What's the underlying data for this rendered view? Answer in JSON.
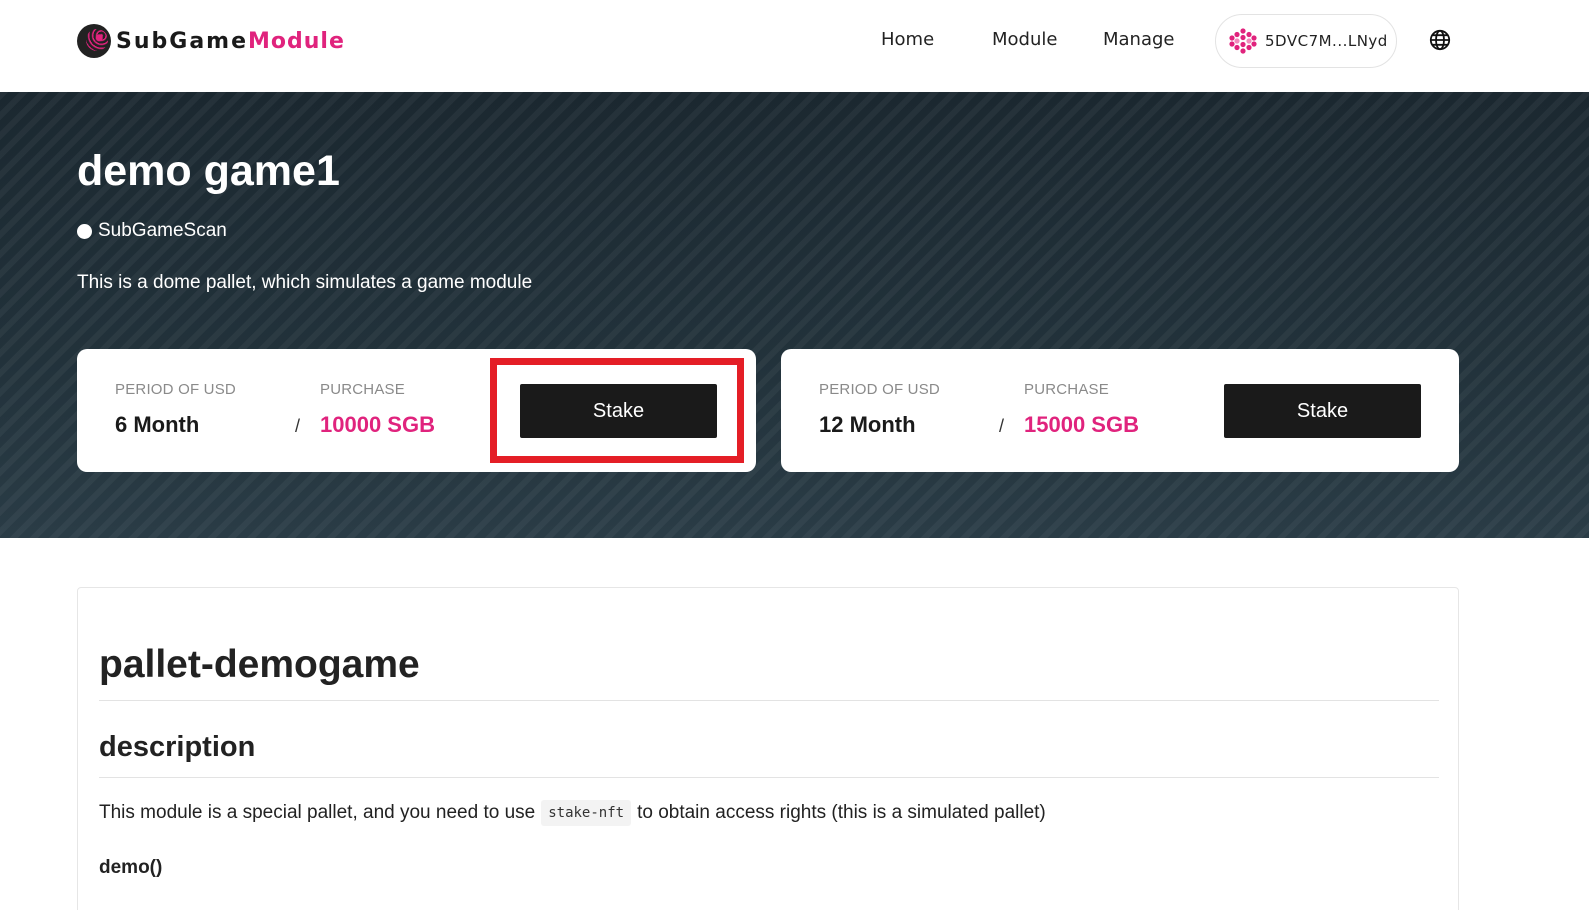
{
  "header": {
    "logo": {
      "part1": "SubGame",
      "part2": "Module"
    },
    "nav": {
      "home": "Home",
      "module": "Module",
      "manage": "Manage"
    },
    "wallet": {
      "address": "5DVC7M...LNyd",
      "icon": "wallet-identicon"
    },
    "language_icon": "globe-icon"
  },
  "hero": {
    "title": "demo game1",
    "link": "SubGameScan",
    "description": "This is a dome pallet, which simulates a game module",
    "plans": [
      {
        "period_label": "PERIOD OF USD",
        "period": "6 Month",
        "purchase_label": "PURCHASE",
        "purchase": "10000 SGB",
        "separator": "/",
        "button": "Stake"
      },
      {
        "period_label": "PERIOD OF USD",
        "period": "12 Month",
        "purchase_label": "PURCHASE",
        "purchase": "15000 SGB",
        "separator": "/",
        "button": "Stake"
      }
    ]
  },
  "doc": {
    "h1": "pallet-demogame",
    "h2": "description",
    "paragraph_before": "This module is a special pallet, and you need to use",
    "paragraph_code": "stake-nft",
    "paragraph_after": "to obtain access rights (this is a simulated pallet)",
    "h4": "demo()"
  },
  "colors": {
    "accent": "#e0237d",
    "hero_bg": "#1f2e36",
    "button_bg": "#1a1a1a",
    "highlight": "#e41e26"
  }
}
